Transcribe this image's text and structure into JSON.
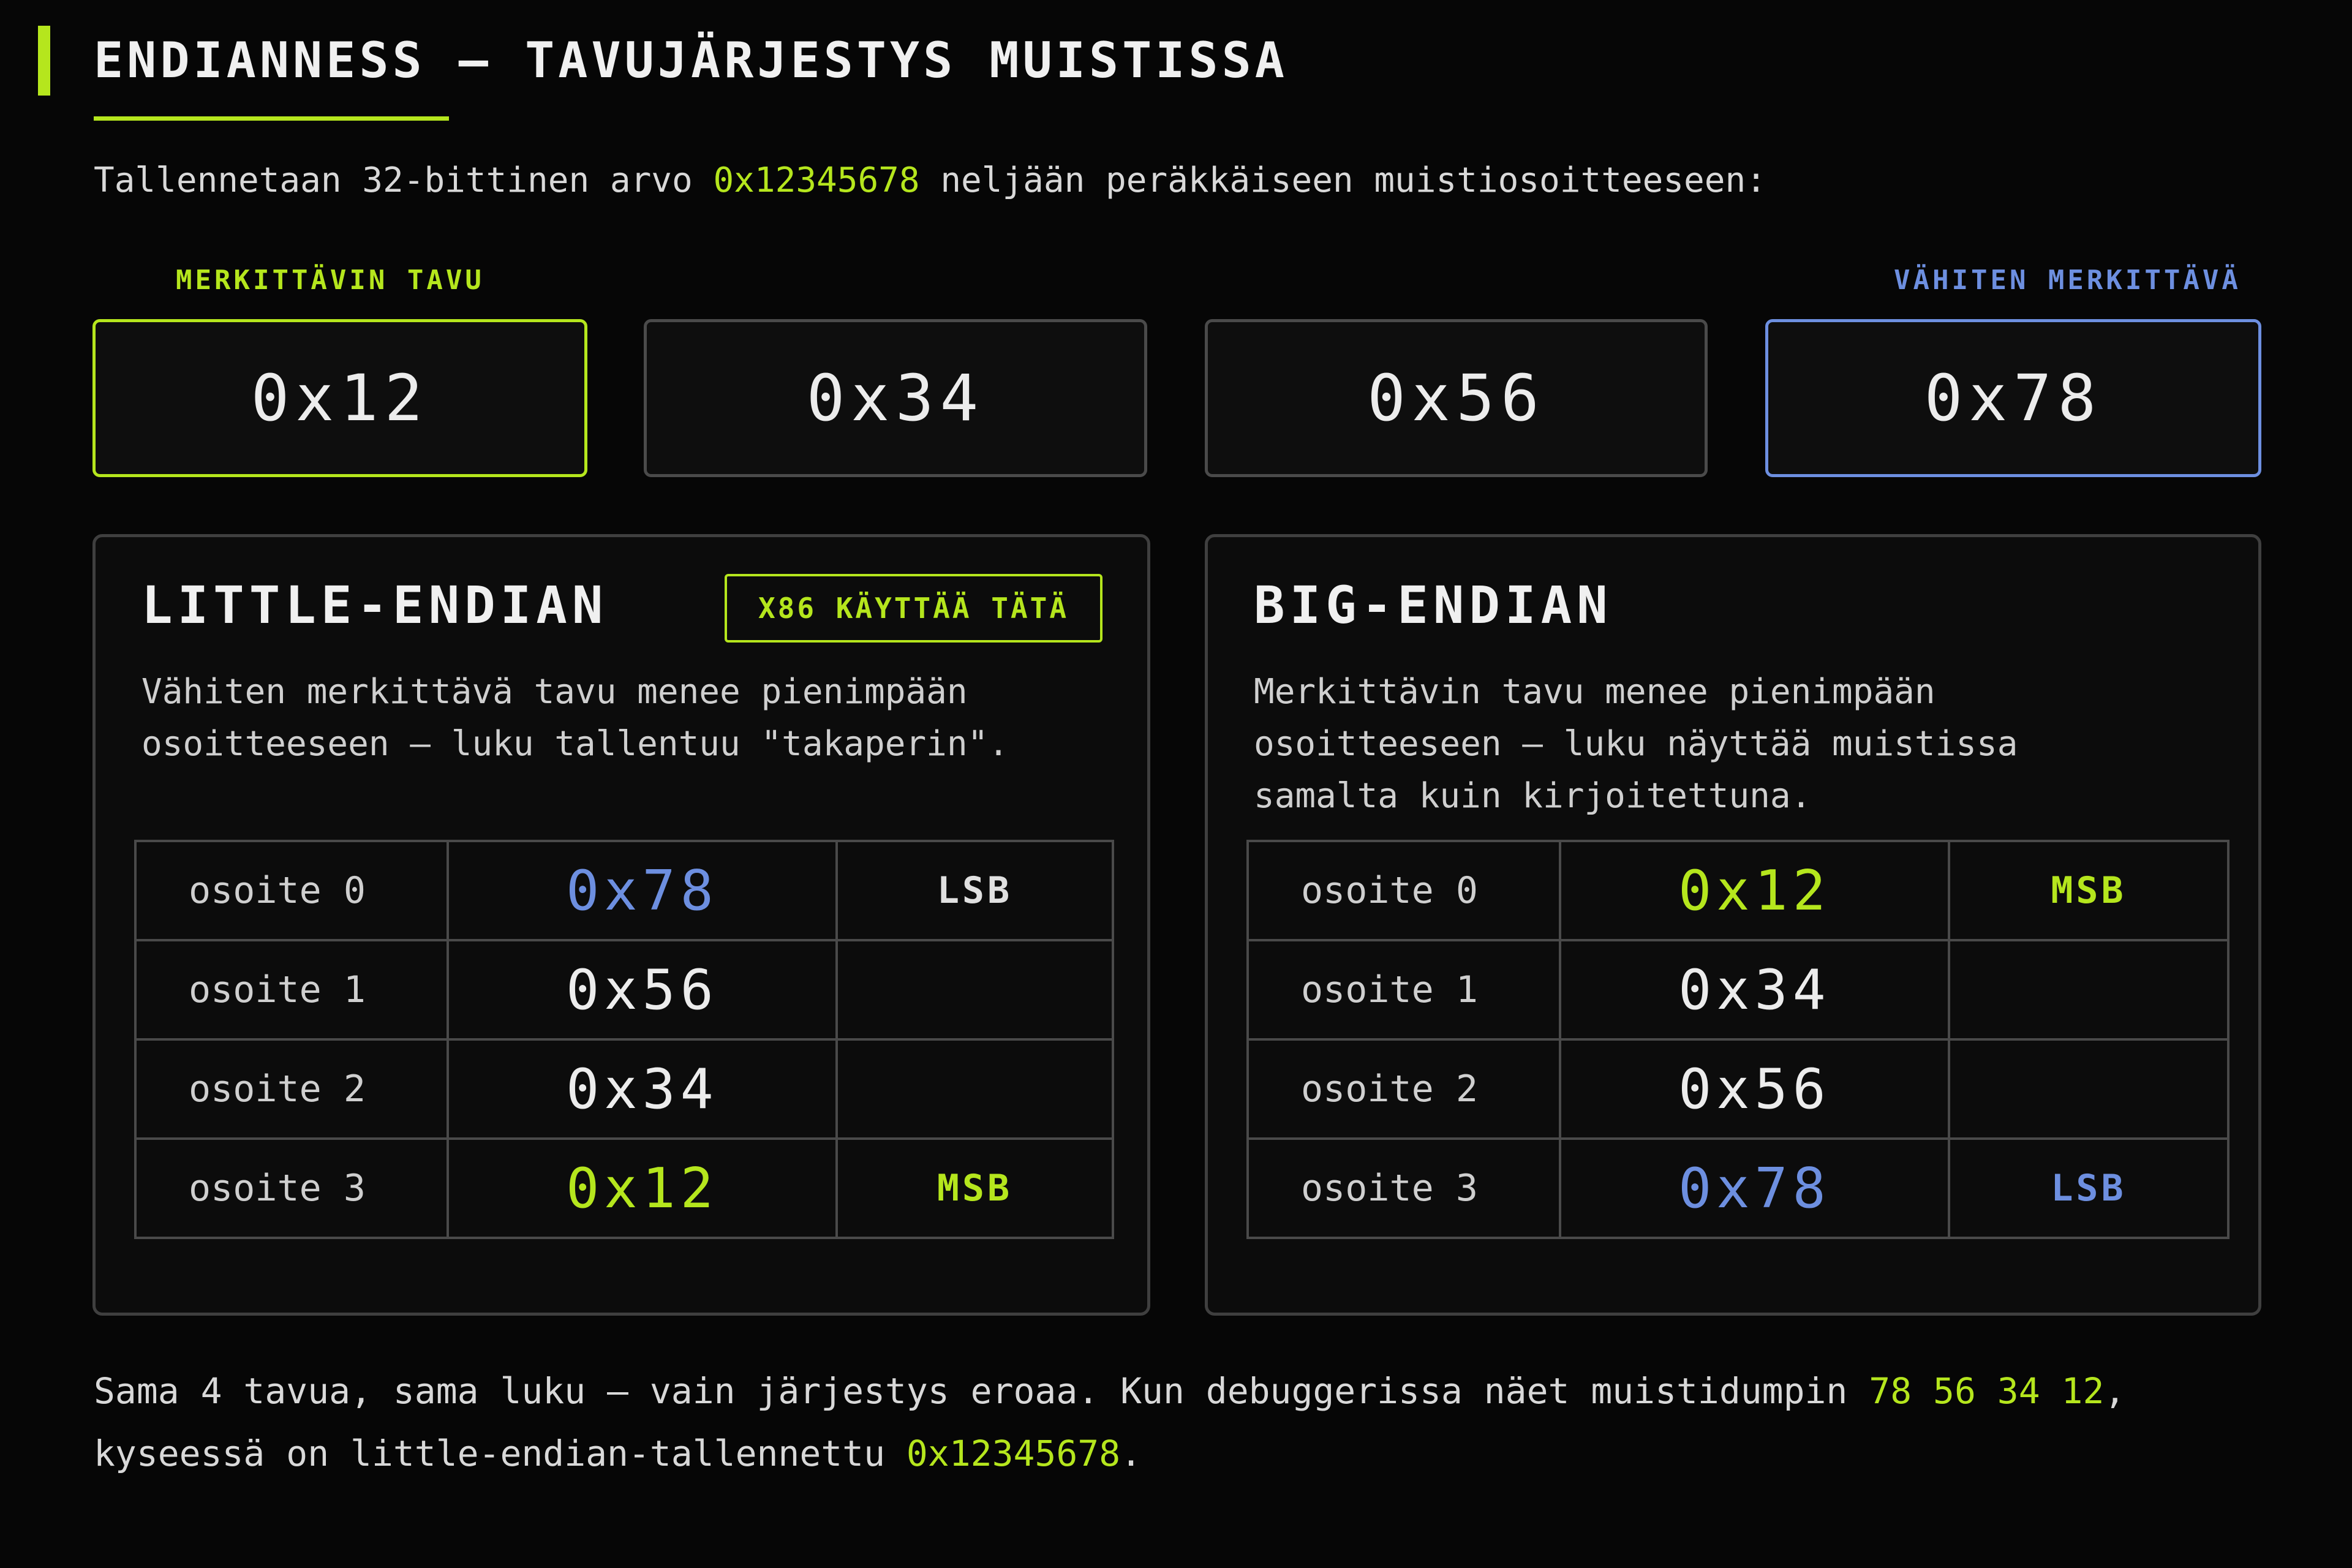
{
  "title": "ENDIANNESS — TAVUJÄRJESTYS MUISTISSA",
  "intro": {
    "before": "Tallennetaan 32-bittinen arvo ",
    "value": "0x12345678",
    "after": " neljään peräkkäiseen muistiosoitteeseen:"
  },
  "byte_captions": {
    "msb": "MERKITTÄVIN TAVU",
    "lsb": "VÄHITEN MERKITTÄVÄ"
  },
  "bytes": [
    "0x12",
    "0x34",
    "0x56",
    "0x78"
  ],
  "little_endian": {
    "title": "LITTLE-ENDIAN",
    "badge": "X86 KÄYTTÄÄ TÄTÄ",
    "desc": [
      "Vähiten merkittävä tavu menee pienimpään",
      "osoitteeseen — luku tallentuu \"takaperin\"."
    ],
    "rows": [
      {
        "addr": "osoite 0",
        "value": "0x78",
        "tag": "LSB"
      },
      {
        "addr": "osoite 1",
        "value": "0x56",
        "tag": ""
      },
      {
        "addr": "osoite 2",
        "value": "0x34",
        "tag": ""
      },
      {
        "addr": "osoite 3",
        "value": "0x12",
        "tag": "MSB"
      }
    ]
  },
  "big_endian": {
    "title": "BIG-ENDIAN",
    "desc": [
      "Merkittävin tavu menee pienimpään",
      "osoitteeseen — luku näyttää muistissa",
      "samalta kuin kirjoitettuna."
    ],
    "rows": [
      {
        "addr": "osoite 0",
        "value": "0x12",
        "tag": "MSB"
      },
      {
        "addr": "osoite 1",
        "value": "0x34",
        "tag": ""
      },
      {
        "addr": "osoite 2",
        "value": "0x56",
        "tag": ""
      },
      {
        "addr": "osoite 3",
        "value": "0x78",
        "tag": "LSB"
      }
    ]
  },
  "footer": {
    "line1_before": "Sama 4 tavua, sama luku — vain järjestys eroaa. Kun debuggerissa näet muistidumpin ",
    "dump": "78 56 34 12",
    "line1_after": ",",
    "line2_before": "kyseessä on little-endian-tallennettu ",
    "value": "0x12345678",
    "line2_after": "."
  },
  "colors": {
    "accent_green": "#b5e61d",
    "accent_blue": "#6d8fe0",
    "background": "#060606",
    "border": "#4a4a4a"
  }
}
